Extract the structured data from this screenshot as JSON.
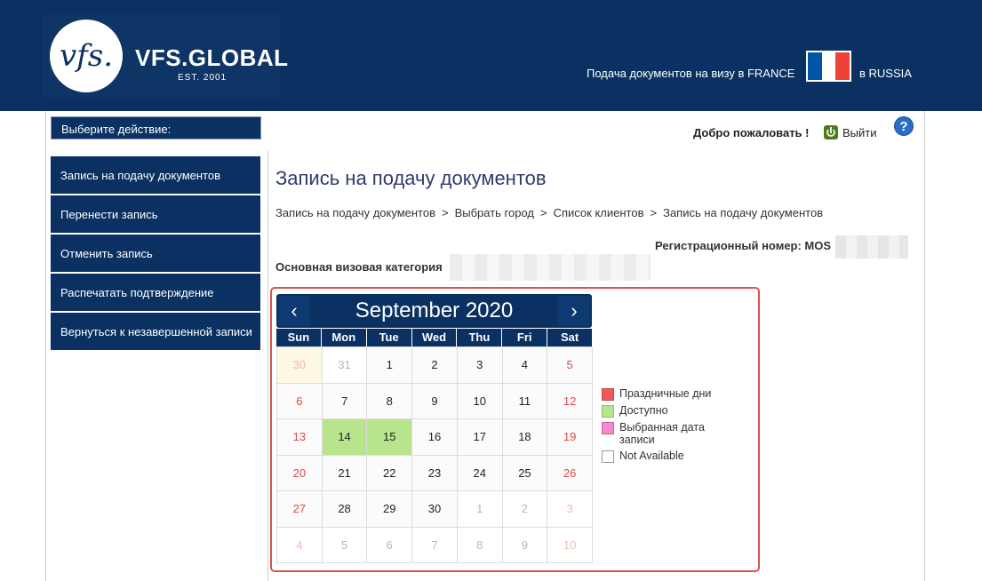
{
  "header": {
    "logo_monogram": "vfs.",
    "logo_name": "VFS.GLOBAL",
    "logo_est": "EST. 2001",
    "visa_text": "Подача документов на визу в FRANCE",
    "country_text": "в RUSSIA",
    "flag_colors": [
      "#0055a4",
      "#ffffff",
      "#ef4135"
    ]
  },
  "sidebar": {
    "title": "Выберите действие:",
    "items": [
      {
        "label": "Запись на подачу документов"
      },
      {
        "label": "Перенести запись"
      },
      {
        "label": "Отменить запись"
      },
      {
        "label": "Распечатать подтверждение"
      },
      {
        "label": "Вернуться к незавершенной записи"
      }
    ]
  },
  "topbar": {
    "welcome": "Добро пожаловать !",
    "logout": "Выйти",
    "help": "?"
  },
  "main": {
    "title": "Запись на подачу документов",
    "breadcrumb": [
      "Запись на подачу документов",
      "Выбрать город",
      "Список клиентов",
      "Запись на подачу документов"
    ],
    "breadcrumb_sep": ">",
    "reg_label": "Регистрационный номер: MOS",
    "category_label": "Основная визовая категория"
  },
  "calendar": {
    "prev": "‹",
    "next": "›",
    "month": "September 2020",
    "weekdays": [
      "Sun",
      "Mon",
      "Tue",
      "Wed",
      "Thu",
      "Fri",
      "Sat"
    ],
    "weeks": [
      [
        "30",
        "31",
        "1",
        "2",
        "3",
        "4",
        "5"
      ],
      [
        "6",
        "7",
        "8",
        "9",
        "10",
        "11",
        "12"
      ],
      [
        "13",
        "14",
        "15",
        "16",
        "17",
        "18",
        "19"
      ],
      [
        "20",
        "21",
        "22",
        "23",
        "24",
        "25",
        "26"
      ],
      [
        "27",
        "28",
        "29",
        "30",
        "1",
        "2",
        "3"
      ],
      [
        "4",
        "5",
        "6",
        "7",
        "8",
        "9",
        "10"
      ]
    ],
    "available_days": [
      "14",
      "15"
    ]
  },
  "legend": [
    {
      "label": "Праздничные дни",
      "color": "#ee5a5a"
    },
    {
      "label": "Доступно",
      "color": "#b8e58c"
    },
    {
      "label": "Выбранная дата записи",
      "color": "#f28cc8"
    },
    {
      "label": "Not Available",
      "color": "#ffffff"
    }
  ]
}
